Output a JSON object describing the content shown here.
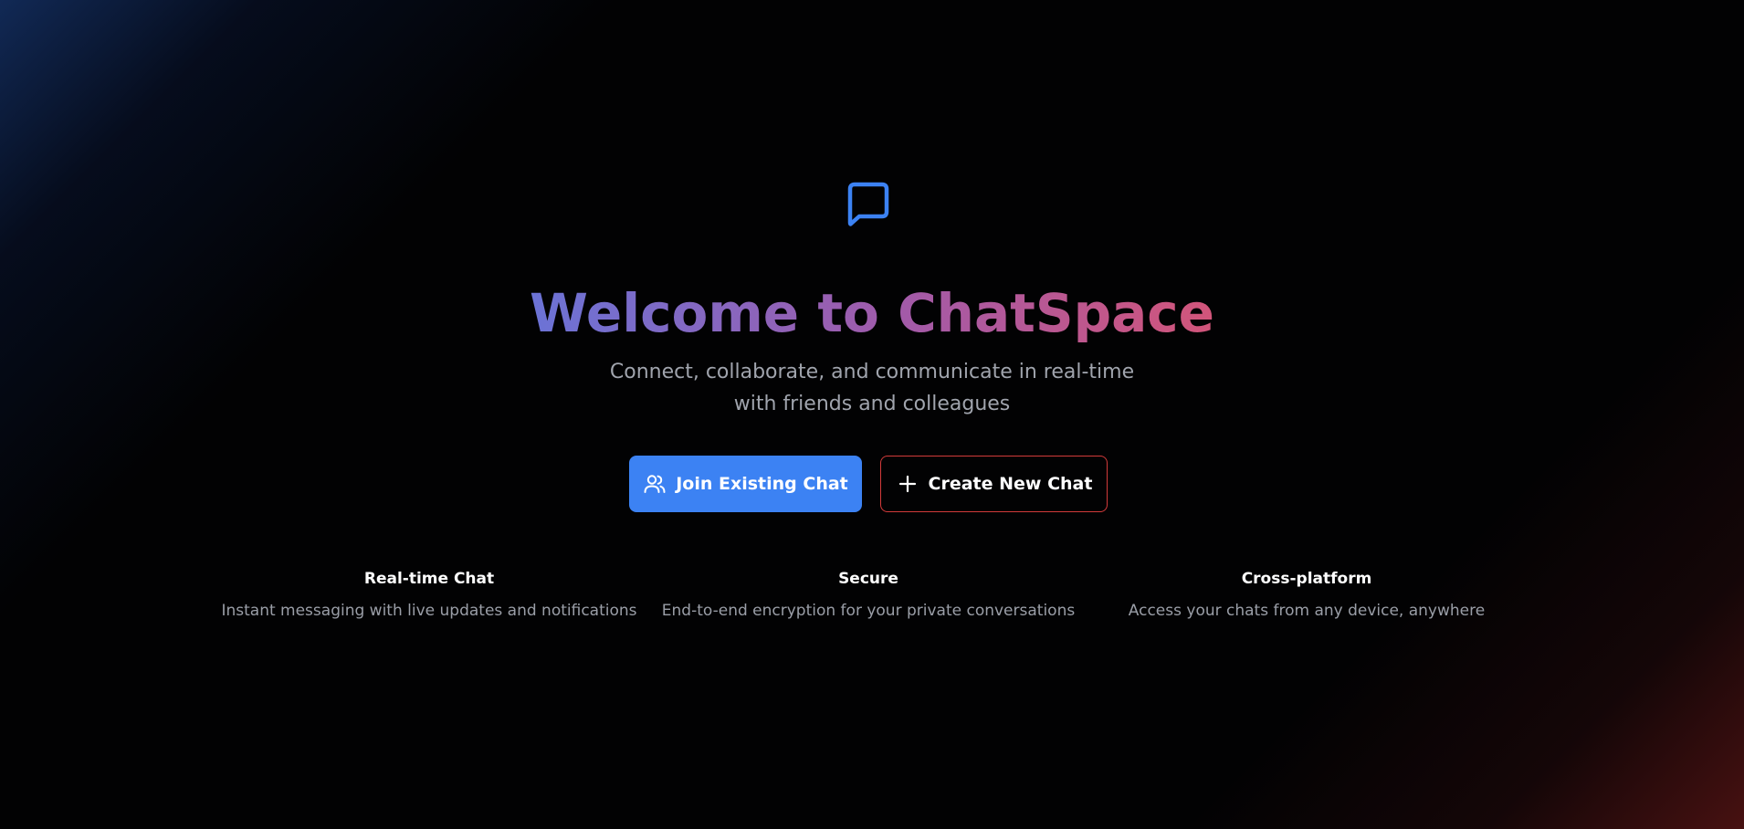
{
  "hero": {
    "logo_icon": "message-square-icon",
    "title": "Welcome to ChatSpace",
    "subtitle": "Connect, collaborate, and communicate in real-time with friends and colleagues"
  },
  "actions": {
    "join": {
      "label": "Join Existing Chat",
      "icon": "users-icon"
    },
    "create": {
      "label": "Create New Chat",
      "icon": "plus-icon"
    }
  },
  "features": [
    {
      "title": "Real-time Chat",
      "description": "Instant messaging with live updates and notifications"
    },
    {
      "title": "Secure",
      "description": "End-to-end encryption for your private conversations"
    },
    {
      "title": "Cross-platform",
      "description": "Access your chats from any device, anywhere"
    }
  ],
  "colors": {
    "primary": "#3c82f3",
    "danger_border": "#d23a3a",
    "title_gradient": [
      "#6b73d6",
      "#a35aa8",
      "#d2557a"
    ],
    "background": "#020203"
  }
}
